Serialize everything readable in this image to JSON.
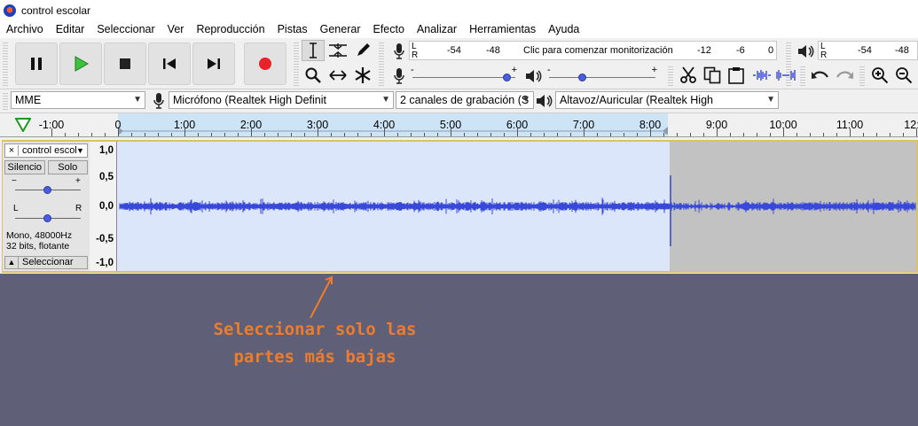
{
  "window": {
    "title": "control escolar"
  },
  "menu": [
    "Archivo",
    "Editar",
    "Seleccionar",
    "Ver",
    "Reproducción",
    "Pistas",
    "Generar",
    "Efecto",
    "Analizar",
    "Herramientas",
    "Ayuda"
  ],
  "recording_meter": {
    "lr_top": "L",
    "lr_bottom": "R",
    "scale": [
      "-54",
      "-48",
      "-12",
      "-6",
      "0"
    ],
    "hint": "Clic para comenzar monitorización"
  },
  "playback_meter": {
    "lr_top": "L",
    "lr_bottom": "R",
    "scale": [
      "-54",
      "-48"
    ]
  },
  "mixer": {
    "minus": "-",
    "plus": "+",
    "record_volume_level": 0.95,
    "playback_volume_level": 0.3
  },
  "devices": {
    "host": "MME",
    "recording_device": "Micrófono (Realtek High Definit",
    "channels": "2 canales de grabación (S",
    "playback_device": "Altavoz/Auricular (Realtek High"
  },
  "timeline": {
    "labels": [
      "-1:00",
      "0",
      "1:00",
      "2:00",
      "3:00",
      "4:00",
      "5:00",
      "6:00",
      "7:00",
      "8:00",
      "9:00",
      "10:00",
      "11:00",
      "12:"
    ]
  },
  "track": {
    "name": "control escol",
    "close": "×",
    "mute": "Silencio",
    "solo": "Solo",
    "gain_minus": "−",
    "gain_plus": "+",
    "pan_left": "L",
    "pan_right": "R",
    "format_line1": "Mono, 48000Hz",
    "format_line2": "32 bits, flotante",
    "select": "Seleccionar",
    "ruler": [
      "1,0",
      "0,5",
      "0,0",
      "-0,5",
      "-1,0"
    ]
  },
  "annotation": {
    "line1": "Seleccionar solo las",
    "line2": "partes más bajas"
  },
  "colors": {
    "selection": "#dce6fb",
    "unselected_wave_bg": "#c2c2c2",
    "waveform": "#3848d8",
    "annotation": "#f07c2a",
    "desktop": "#5f6078"
  }
}
